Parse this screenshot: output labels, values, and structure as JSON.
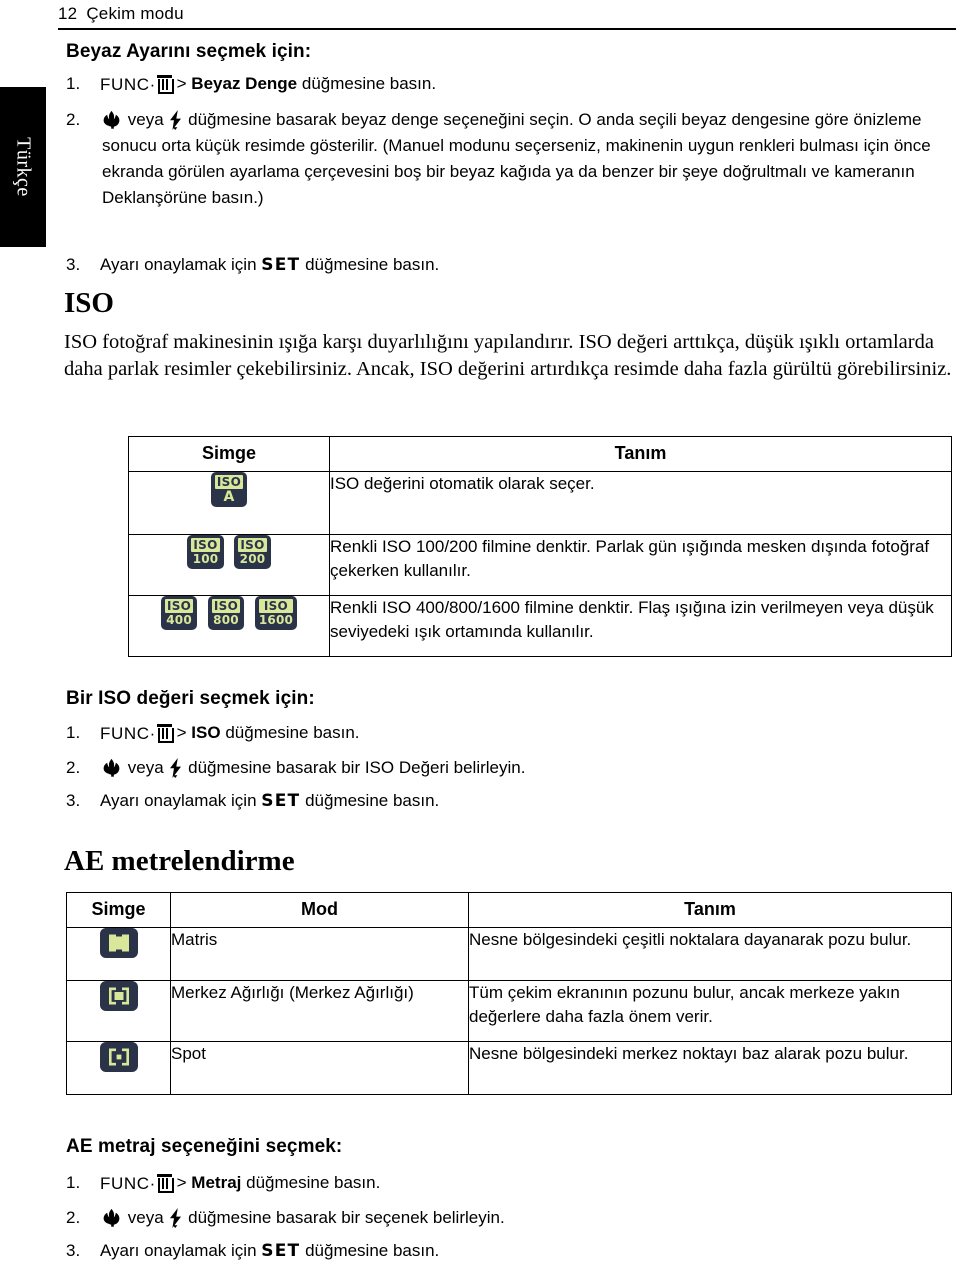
{
  "page": {
    "number": "12",
    "chapter": "Çekim modu",
    "side_tab_label": "Türkçe"
  },
  "colors": {
    "icon_background": "#2a3348",
    "icon_foreground": "#d9e79a",
    "text": "#000000",
    "rule": "#000000"
  },
  "white_balance": {
    "heading": "Beyaz Ayarını seçmek için:",
    "steps": [
      {
        "index": "1.",
        "icon": "func-trash-icon",
        "separator": ">",
        "bold_part": "Beyaz Denge",
        "rest": "düğmesine basın."
      },
      {
        "index": "2.",
        "icon_a": "macro-tulip-icon",
        "conjunction": "veya",
        "icon_b": "flash-bolt-icon",
        "text": "düğmesine basarak beyaz denge seçeneğini seçin. O anda seçili beyaz dengesine göre önizleme sonucu orta küçük resimde gösterilir. (Manuel modunu seçerseniz, makinenin uygun renkleri bulması için önce ekranda görülen ayarlama çerçevesini boş bir beyaz kağıda ya da benzer bir şeye doğrultmalı ve kameranın Deklanşörüne basın.)"
      },
      {
        "index": "3.",
        "prefix": "Ayarı onaylamak için",
        "icon": "set-key-icon",
        "icon_label": "SET",
        "suffix": "düğmesine basın."
      }
    ]
  },
  "iso": {
    "heading": "ISO",
    "body": "ISO fotoğraf makinesinin ışığa karşı duyarlılığını yapılandırır. ISO değeri arttıkça, düşük ışıklı ortamlarda daha parlak resimler çekebilirsiniz. Ancak, ISO değerini artırdıkça resimde daha fazla gürültü görebilirsiniz.",
    "table": {
      "headers": [
        "Simge",
        "Tanım"
      ],
      "rows": [
        {
          "icons": [
            {
              "label": "ISO",
              "value": "A",
              "style": "inverted"
            }
          ],
          "description": "ISO değerini otomatik olarak seçer."
        },
        {
          "icons": [
            {
              "label": "ISO",
              "value": "100",
              "style": "light"
            },
            {
              "label": "ISO",
              "value": "200",
              "style": "light"
            }
          ],
          "description": "Renkli ISO 100/200 filmine denktir. Parlak gün ışığında mesken dışında fotoğraf çekerken kullanılır."
        },
        {
          "icons": [
            {
              "label": "ISO",
              "value": "400",
              "style": "dark"
            },
            {
              "label": "ISO",
              "value": "800",
              "style": "dark"
            },
            {
              "label": "ISO",
              "value": "1600",
              "style": "dark"
            }
          ],
          "description": "Renkli ISO 400/800/1600 filmine denktir. Flaş ışığına izin verilmeyen veya düşük seviyedeki ışık ortamında kullanılır."
        }
      ]
    },
    "select_heading": "Bir ISO değeri seçmek için:",
    "select_steps": [
      {
        "index": "1.",
        "icon": "func-trash-icon",
        "separator": ">",
        "bold_part": "ISO",
        "rest": "düğmesine basın."
      },
      {
        "index": "2.",
        "icon_a": "macro-tulip-icon",
        "conjunction": "veya",
        "icon_b": "flash-bolt-icon",
        "text": "düğmesine basarak bir ISO Değeri belirleyin."
      },
      {
        "index": "3.",
        "prefix": "Ayarı onaylamak için",
        "icon": "set-key-icon",
        "icon_label": "SET",
        "suffix": "düğmesine basın."
      }
    ]
  },
  "ae": {
    "heading": "AE metrelendirme",
    "table": {
      "headers": [
        "Simge",
        "Mod",
        "Tanım"
      ],
      "rows": [
        {
          "icon": "ae-matrix-icon",
          "mode": "Matris",
          "description": "Nesne bölgesindeki çeşitli noktalara dayanarak pozu bulur."
        },
        {
          "icon": "ae-center-weighted-icon",
          "mode": "Merkez Ağırlığı (Merkez Ağırlığı)",
          "description": "Tüm çekim ekranının pozunu bulur, ancak merkeze yakın değerlere daha fazla önem verir."
        },
        {
          "icon": "ae-spot-icon",
          "mode": "Spot",
          "description": "Nesne bölgesindeki merkez noktayı baz alarak pozu bulur."
        }
      ]
    },
    "select_heading": "AE metraj seçeneğini seçmek:",
    "select_steps": [
      {
        "index": "1.",
        "icon": "func-trash-icon",
        "separator": ">",
        "bold_part": "Metraj",
        "rest": "düğmesine basın."
      },
      {
        "index": "2.",
        "icon_a": "macro-tulip-icon",
        "conjunction": "veya",
        "icon_b": "flash-bolt-icon",
        "text": "düğmesine basarak bir seçenek belirleyin."
      },
      {
        "index": "3.",
        "prefix": "Ayarı onaylamak için",
        "icon": "set-key-icon",
        "icon_label": "SET",
        "suffix": "düğmesine basın."
      }
    ]
  },
  "glyphs": {
    "func_text": "FUNC·",
    "gt": ">",
    "veya": "veya",
    "set": "SET"
  }
}
